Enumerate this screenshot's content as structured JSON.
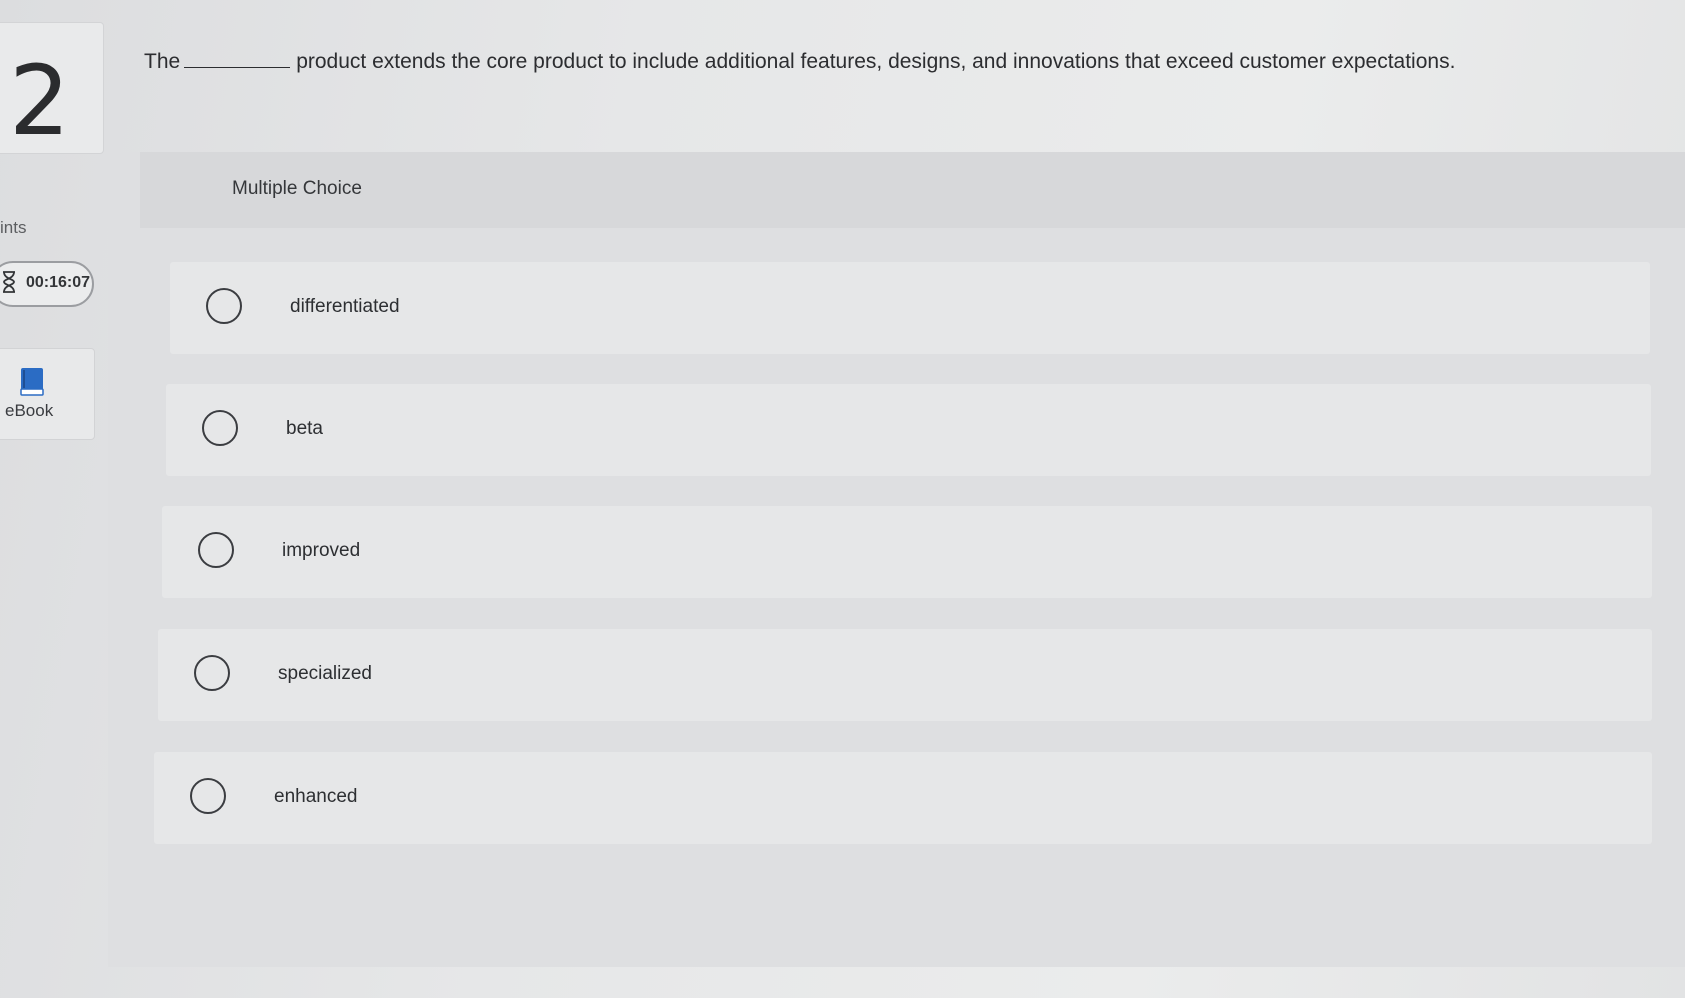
{
  "question": {
    "number": "2",
    "text_before_blank": "The",
    "text_after_blank": "product extends the core product to include additional features, designs, and innovations that exceed customer expectations."
  },
  "sidebar": {
    "points_label": "ints",
    "timer": "00:16:07",
    "ebook_label": "eBook"
  },
  "answer_panel": {
    "type_label": "Multiple Choice",
    "options": [
      {
        "label": "differentiated"
      },
      {
        "label": "beta"
      },
      {
        "label": "improved"
      },
      {
        "label": "specialized"
      },
      {
        "label": "enhanced"
      }
    ]
  },
  "colors": {
    "ebook_icon": "#2b6cc4",
    "background": "#e4e5e6"
  }
}
